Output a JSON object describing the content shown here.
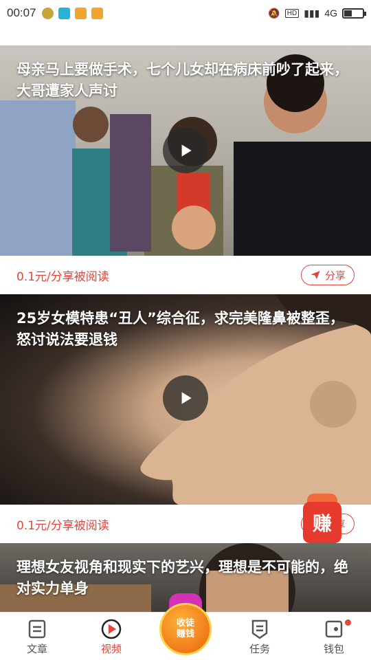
{
  "status_bar": {
    "time": "00:07",
    "network": "4G",
    "hd_label": "HD"
  },
  "feed": [
    {
      "title": "母亲马上要做手术，七个儿女却在病床前吵了起来，大哥遭家人声讨",
      "reward": "0.1元/分享被阅读",
      "share_label": "分享"
    },
    {
      "title": "25岁女模特患“丑人”综合征，求完美隆鼻被整歪，怒讨说法要退钱",
      "reward": "0.1元/分享被阅读",
      "share_label": "分享"
    },
    {
      "title": "理想女友视角和现实下的艺兴，理想是不可能的，绝对实力单身"
    }
  ],
  "earn_badge": "赚",
  "tabbar": {
    "articles": "文章",
    "videos": "视频",
    "center": [
      "收徒",
      "赚钱"
    ],
    "tasks": "任务",
    "wallet": "钱包"
  },
  "colors": {
    "accent": "#e2463c",
    "badge": "#e73a2e"
  }
}
